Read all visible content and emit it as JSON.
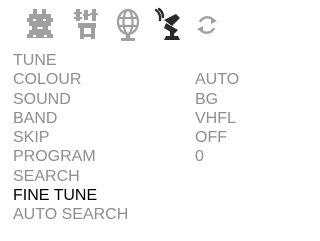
{
  "icons": [
    {
      "name": "picture-icon"
    },
    {
      "name": "setup-icon"
    },
    {
      "name": "globe-icon"
    },
    {
      "name": "tune-icon"
    },
    {
      "name": "sync-icon"
    }
  ],
  "menu": {
    "rows": [
      {
        "label": "TUNE",
        "value": ""
      },
      {
        "label": "COLOUR",
        "value": "AUTO"
      },
      {
        "label": "SOUND",
        "value": "BG"
      },
      {
        "label": "BAND",
        "value": "VHFL"
      },
      {
        "label": "SKIP",
        "value": "OFF"
      },
      {
        "label": "PROGRAM",
        "value": "0"
      },
      {
        "label": "SEARCH",
        "value": ""
      },
      {
        "label": "FINE TUNE",
        "value": ""
      },
      {
        "label": "AUTO SEARCH",
        "value": ""
      }
    ],
    "selected_index": 7
  },
  "colors": {
    "background": "#ffffff",
    "inactive_text": "#8e8e8e",
    "active_text": "#000000",
    "icon_gray": "#a0a0a0",
    "icon_dark": "#2a2a2a"
  }
}
